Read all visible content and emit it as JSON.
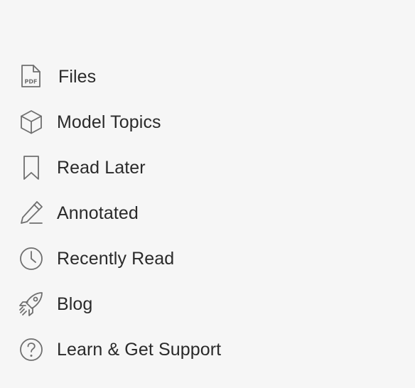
{
  "sidebar": {
    "items": [
      {
        "key": "files",
        "label": "Files",
        "icon": "pdf-file-icon",
        "icon_text": "PDF"
      },
      {
        "key": "model-topics",
        "label": "Model Topics",
        "icon": "cube-icon"
      },
      {
        "key": "read-later",
        "label": "Read Later",
        "icon": "bookmark-icon"
      },
      {
        "key": "annotated",
        "label": "Annotated",
        "icon": "pencil-icon"
      },
      {
        "key": "recently-read",
        "label": "Recently Read",
        "icon": "clock-icon"
      },
      {
        "key": "blog",
        "label": "Blog",
        "icon": "rocket-icon"
      },
      {
        "key": "learn-support",
        "label": "Learn & Get Support",
        "icon": "question-circle-icon"
      }
    ]
  },
  "colors": {
    "background": "#f6f6f6",
    "text": "#2a2a2a",
    "icon_stroke": "#6f6f6f"
  }
}
